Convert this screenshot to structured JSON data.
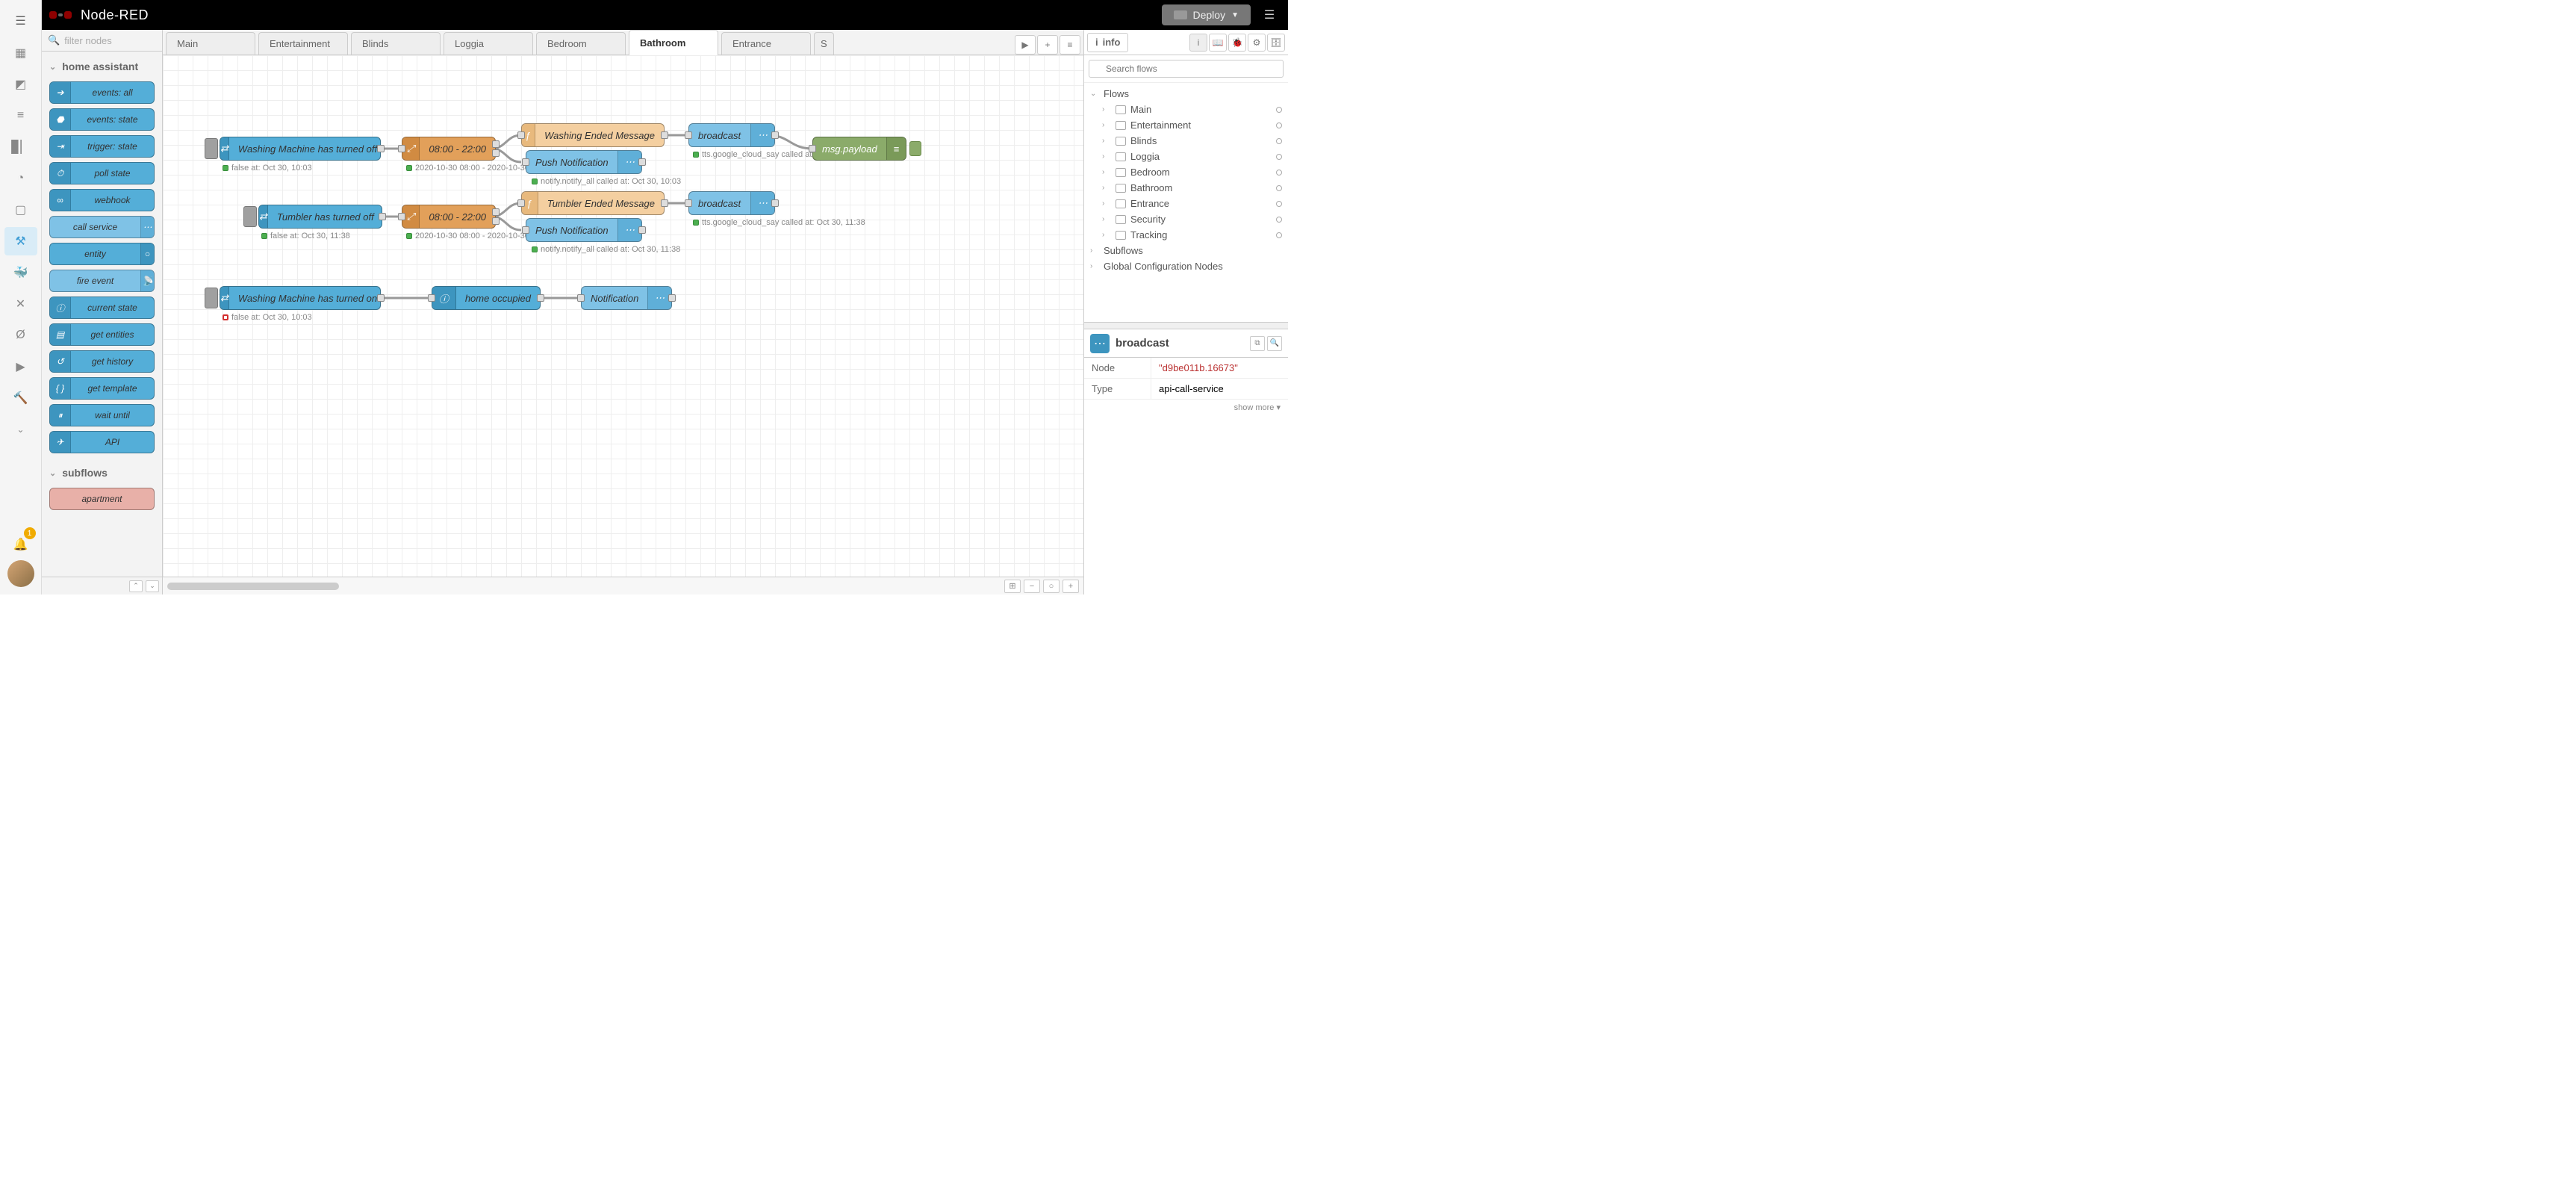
{
  "header": {
    "title": "Node-RED",
    "deploy": "Deploy"
  },
  "activity_badge": "1",
  "palette": {
    "search_placeholder": "filter nodes",
    "cat1": "home assistant",
    "cat2": "subflows",
    "nodes": {
      "eventsall": "events: all",
      "eventsstate": "events: state",
      "triggerstate": "trigger: state",
      "pollstate": "poll state",
      "webhook": "webhook",
      "callservice": "call service",
      "entity": "entity",
      "fireevent": "fire event",
      "currentstate": "current state",
      "getentities": "get entities",
      "gethistory": "get history",
      "gettemplate": "get template",
      "waituntil": "wait until",
      "api": "API",
      "apartment": "apartment"
    }
  },
  "tabs": {
    "main": "Main",
    "entertainment": "Entertainment",
    "blinds": "Blinds",
    "loggia": "Loggia",
    "bedroom": "Bedroom",
    "bathroom": "Bathroom",
    "entrance": "Entrance",
    "s": "S"
  },
  "flow": {
    "wm_off": "Washing Machine has turned off",
    "wm_off_status": "false at: Oct 30, 10:03",
    "tumbler_off": "Tumbler has turned off",
    "tumbler_off_status": "false at: Oct 30, 11:38",
    "wm_on": "Washing Machine has turned on",
    "wm_on_status": "false at: Oct 30, 10:03",
    "time1": "08:00 - 22:00",
    "time1_status": "2020-10-30 08:00 - 2020-10-30 22:00",
    "time2": "08:00 - 22:00",
    "time2_status": "2020-10-30 08:00 - 2020-10-30 22:00",
    "wash_msg": "Washing Ended Message",
    "tumb_msg": "Tumbler Ended Message",
    "push1": "Push Notification",
    "push1_status": "notify.notify_all called at: Oct 30, 10:03",
    "push2": "Push Notification",
    "push2_status": "notify.notify_all called at: Oct 30, 11:38",
    "broadcast1": "broadcast",
    "broadcast1_status": "tts.google_cloud_say called at.",
    "broadcast2": "broadcast",
    "broadcast2_status": "tts.google_cloud_say called at: Oct 30, 11:38",
    "home_occ": "home occupied",
    "notification": "Notification",
    "msgpayload": "msg.payload"
  },
  "sidebar": {
    "info_label": "info",
    "search_placeholder": "Search flows",
    "tree": {
      "flows": "Flows",
      "main": "Main",
      "entertainment": "Entertainment",
      "blinds": "Blinds",
      "loggia": "Loggia",
      "bedroom": "Bedroom",
      "bathroom": "Bathroom",
      "entrance": "Entrance",
      "security": "Security",
      "tracking": "Tracking",
      "subflows": "Subflows",
      "global": "Global Configuration Nodes"
    },
    "detail": {
      "title": "broadcast",
      "node_k": "Node",
      "node_v": "\"d9be011b.16673\"",
      "type_k": "Type",
      "type_v": "api-call-service",
      "more": "show more ▾"
    }
  }
}
